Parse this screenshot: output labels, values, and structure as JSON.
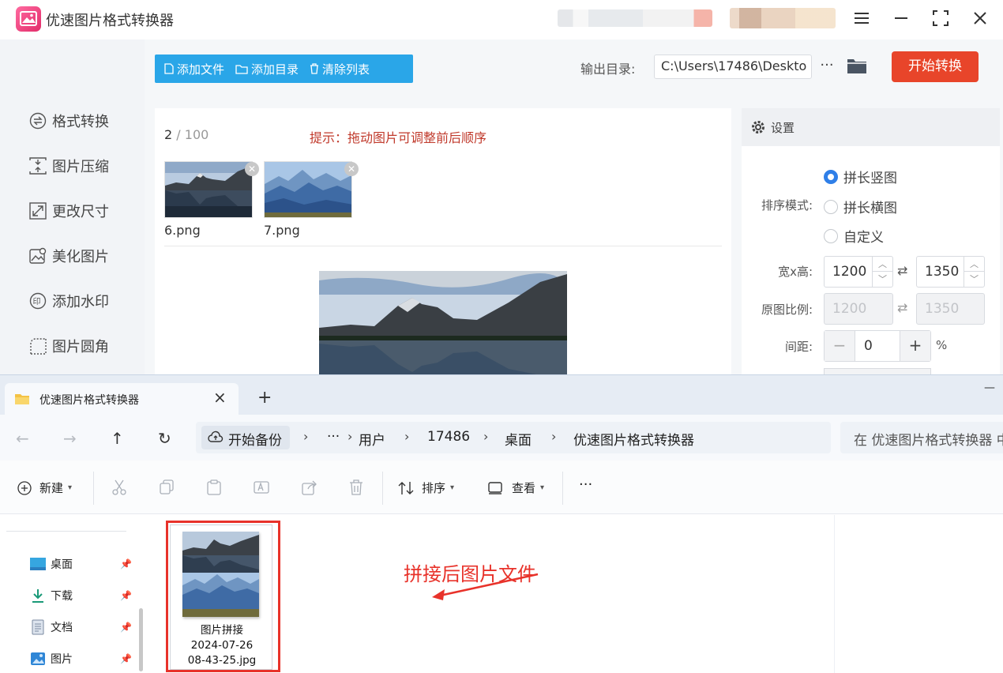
{
  "app": {
    "title": "优速图片格式转换器",
    "sidebar": [
      {
        "label": "格式转换",
        "icon": "format-convert-icon"
      },
      {
        "label": "图片压缩",
        "icon": "compress-icon"
      },
      {
        "label": "更改尺寸",
        "icon": "resize-icon"
      },
      {
        "label": "美化图片",
        "icon": "beautify-icon"
      },
      {
        "label": "添加水印",
        "icon": "watermark-icon"
      },
      {
        "label": "图片圆角",
        "icon": "round-corner-icon"
      }
    ],
    "toolbar": {
      "add_file": "添加文件",
      "add_folder": "添加目录",
      "clear_list": "清除列表"
    },
    "output": {
      "label": "输出目录:",
      "path": "C:\\Users\\17486\\Deskto",
      "more": "···"
    },
    "start_button": "开始转换",
    "work": {
      "count": "2",
      "separator": "/",
      "total": "100",
      "hint": "提示：拖动图片可调整前后顺序",
      "files": [
        {
          "name": "6.png"
        },
        {
          "name": "7.png"
        }
      ]
    },
    "settings": {
      "title": "设置",
      "sort_label": "排序模式:",
      "sort_options": [
        "拼长竖图",
        "拼长横图",
        "自定义"
      ],
      "sort_selected": "拼长竖图",
      "size_label": "宽x高:",
      "width": "1200",
      "height": "1350",
      "ratio_label": "原图比例:",
      "ratio_width": "1200",
      "ratio_height": "1350",
      "gap_label": "间距:",
      "gap_value": "0",
      "gap_unit": "%"
    }
  },
  "explorer": {
    "tab_title": "优速图片格式转换器",
    "breadcrumb": {
      "start": "开始备份",
      "more": "···",
      "items": [
        "用户",
        "17486",
        "桌面",
        "优速图片格式转换器"
      ]
    },
    "search_placeholder": "在 优速图片格式转换器 中",
    "commands": {
      "new": "新建",
      "sort": "排序",
      "view": "查看",
      "more": "···"
    },
    "nav": [
      {
        "label": "桌面"
      },
      {
        "label": "下载"
      },
      {
        "label": "文档"
      },
      {
        "label": "图片"
      }
    ],
    "file": {
      "line1": "图片拼接",
      "line2": "2024-07-26",
      "line3": "08-43-25.jpg"
    },
    "annotation": "拼接后图片文件"
  },
  "colors": {
    "toolbar_blue": "#2aa6e8",
    "start_red": "#e8452a",
    "hint_red": "#c0392b",
    "radio_blue": "#2f7fe8",
    "annotation_red": "#e8322a"
  }
}
